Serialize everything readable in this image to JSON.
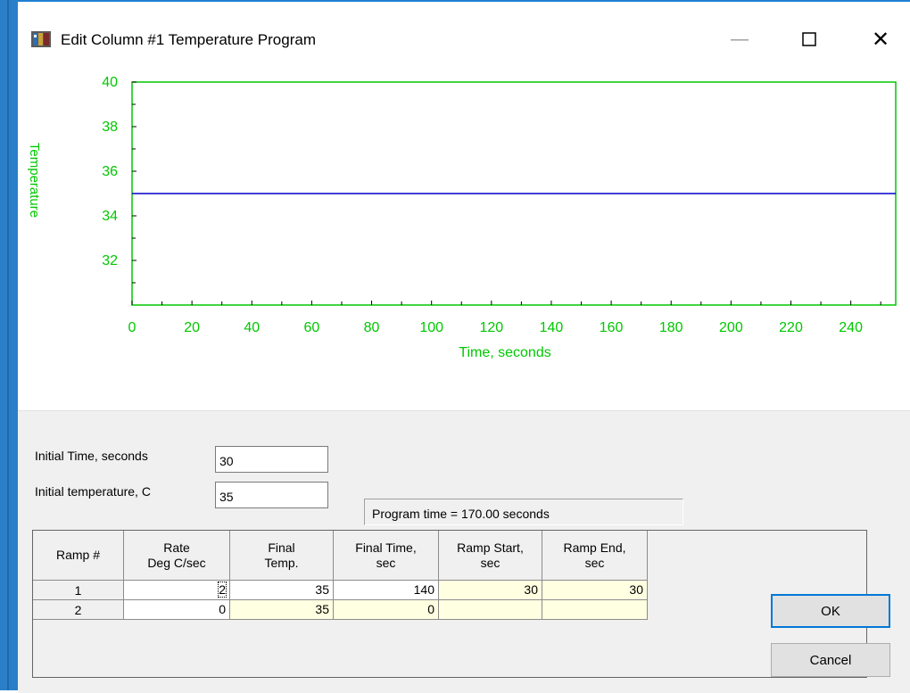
{
  "window": {
    "title": "Edit Column #1 Temperature Program"
  },
  "chart_data": {
    "type": "line",
    "title": "",
    "xlabel": "Time, seconds",
    "ylabel": "Temperature",
    "xlim": [
      0,
      255
    ],
    "ylim": [
      30,
      40
    ],
    "x_ticks": [
      "0",
      "20",
      "40",
      "60",
      "80",
      "100",
      "120",
      "140",
      "160",
      "180",
      "200",
      "220",
      "240"
    ],
    "y_ticks": [
      "40",
      "38",
      "36",
      "34",
      "32"
    ],
    "series": [
      {
        "x": [
          0,
          255
        ],
        "y": [
          35,
          35
        ],
        "color": "#0000c8"
      }
    ],
    "axis_color": "#00c800",
    "grid": false
  },
  "form": {
    "initial_time_label": "Initial Time, seconds",
    "initial_time_value": "30",
    "initial_temp_label": "Initial temperature, C",
    "initial_temp_value": "35",
    "program_time": "Program time = 170.00 seconds"
  },
  "table": {
    "headers": [
      "Ramp #",
      "Rate\nDeg C/sec",
      "Final\nTemp.",
      "Final Time,\nsec",
      "Ramp Start,\nsec",
      "Ramp End,\nsec"
    ],
    "rows": [
      [
        "1",
        "2",
        "35",
        "140",
        "30",
        "30"
      ],
      [
        "2",
        "0",
        "35",
        "0",
        "",
        ""
      ]
    ]
  },
  "buttons": {
    "ok": "OK",
    "cancel": "Cancel"
  },
  "colors": {
    "window_border": "#1e7fd4",
    "readonly_cell": "#ffffe1",
    "dialog_bg": "#f0f0f0"
  }
}
